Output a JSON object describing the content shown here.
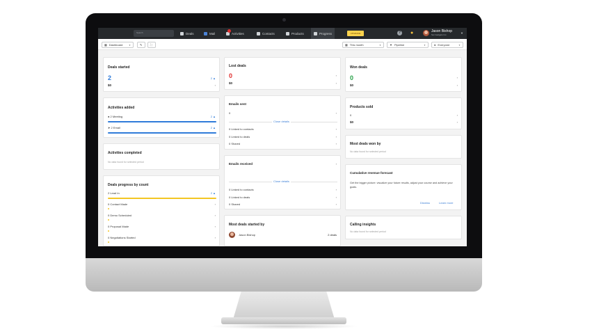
{
  "nav": {
    "search_placeholder": "Search",
    "items": [
      {
        "label": "Deals",
        "active": false
      },
      {
        "label": "Mail",
        "active": false
      },
      {
        "label": "Activities",
        "active": false
      },
      {
        "label": "Contacts",
        "active": false
      },
      {
        "label": "Products",
        "active": false
      },
      {
        "label": "Progress",
        "active": true
      }
    ],
    "upgrade_label": "UPGRADE",
    "help_label": "?",
    "user_name": "Jason Bishop",
    "user_company": "Set Gadgets Inc."
  },
  "toolbar": {
    "dashboard_label": "Dashboard",
    "period_label": "This month",
    "pipeline_label": "Pipeline",
    "user_filter_label": "Everyone"
  },
  "left": {
    "deals_started": {
      "title": "Deals started",
      "count": "2",
      "amount": "$0",
      "change": "2"
    },
    "activities_added": {
      "title": "Activities added",
      "rows": [
        {
          "label": "2 Meeting",
          "value": "2"
        },
        {
          "label": "2 Email",
          "value": "2"
        }
      ]
    },
    "activities_completed": {
      "title": "Activities completed",
      "empty": "No data found for selected period"
    },
    "deals_progress": {
      "title": "Deals progress by count",
      "rows": [
        {
          "label": "2 Lead In",
          "value": "2"
        },
        {
          "label": "0 Contact Made",
          "value": ""
        },
        {
          "label": "0 Demo Scheduled",
          "value": ""
        },
        {
          "label": "0 Proposal Made",
          "value": ""
        },
        {
          "label": "0 Negotiations Started",
          "value": ""
        }
      ]
    }
  },
  "middle": {
    "lost_deals": {
      "title": "Lost deals",
      "count": "0",
      "amount": "$0"
    },
    "emails_sent": {
      "title": "Emails sent",
      "count": "0",
      "close_details": "Close details",
      "rows": [
        "0 Linked to contacts",
        "0 Linked to deals",
        "0 Shared"
      ]
    },
    "emails_received": {
      "title": "Emails received",
      "close_details": "Close details",
      "rows": [
        "0 Linked to contacts",
        "0 Linked to deals",
        "0 Shared"
      ]
    },
    "most_deals_started": {
      "title": "Most deals started by",
      "person": "Jason Bishop",
      "deals": "2 deals"
    }
  },
  "right": {
    "won_deals": {
      "title": "Won deals",
      "count": "0",
      "amount": "$0"
    },
    "products_sold": {
      "title": "Products sold",
      "count": "0",
      "amount": "$0"
    },
    "most_deals_won": {
      "title": "Most deals won by",
      "empty": "No data found for selected period"
    },
    "revenue_forecast": {
      "title": "Cumulative revenue forecast",
      "text": "Get the bigger picture: visualize your future results, adjust your course and achieve your goals.",
      "dismiss": "Dismiss",
      "learn_more": "Learn more"
    },
    "calling_insights": {
      "title": "Calling insights",
      "empty": "No data found for selected period"
    }
  },
  "colors": {
    "blue": "#2f7bd9",
    "red": "#e03131",
    "green": "#2aa24a",
    "yellow": "#f3c623",
    "nav": "#26292c"
  }
}
